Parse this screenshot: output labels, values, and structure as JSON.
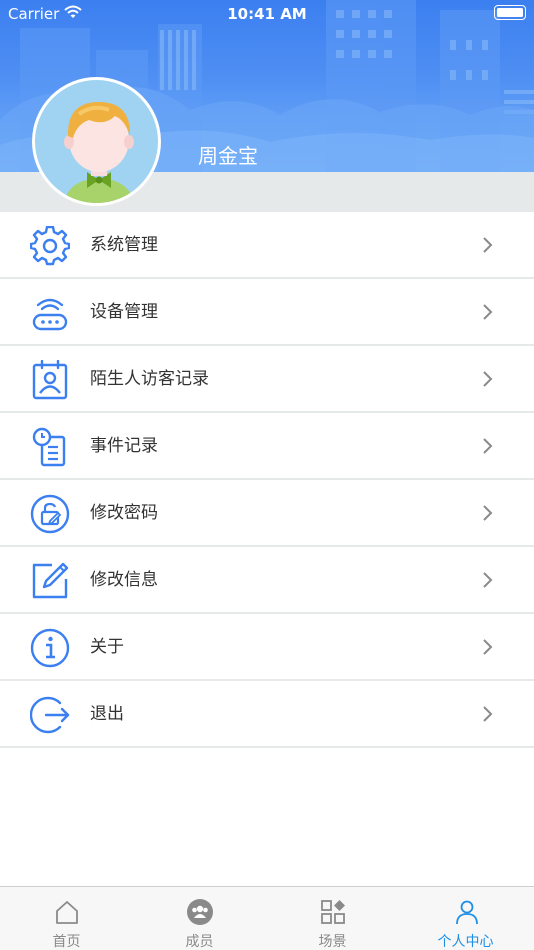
{
  "status_bar": {
    "carrier": "Carrier",
    "time": "10:41 AM"
  },
  "profile": {
    "name": "周金宝"
  },
  "colors": {
    "accent": "#1e8fe6",
    "icon_blue": "#3b7ff0",
    "header_blue": "#3b7ff0",
    "divider": "#e6e9ea"
  },
  "menu": [
    {
      "label": "系统管理",
      "icon": "gear-icon"
    },
    {
      "label": "设备管理",
      "icon": "router-icon"
    },
    {
      "label": "陌生人访客记录",
      "icon": "visitor-card-icon"
    },
    {
      "label": "事件记录",
      "icon": "clock-document-icon"
    },
    {
      "label": "修改密码",
      "icon": "lock-edit-icon"
    },
    {
      "label": "修改信息",
      "icon": "edit-square-icon"
    },
    {
      "label": "关于",
      "icon": "info-icon"
    },
    {
      "label": "退出",
      "icon": "logout-icon"
    }
  ],
  "tabbar": [
    {
      "label": "首页",
      "icon": "home-icon",
      "active": false
    },
    {
      "label": "成员",
      "icon": "members-icon",
      "active": false
    },
    {
      "label": "场景",
      "icon": "scene-icon",
      "active": false
    },
    {
      "label": "个人中心",
      "icon": "person-icon",
      "active": true
    }
  ]
}
